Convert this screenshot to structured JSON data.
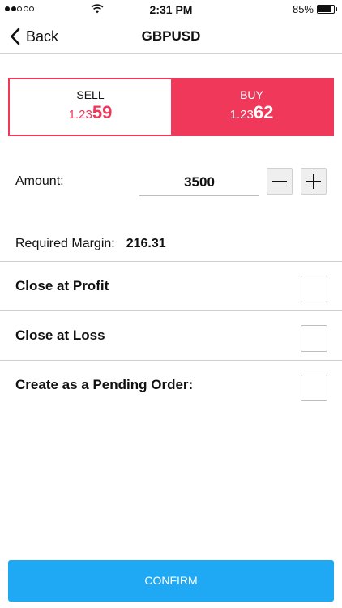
{
  "status_bar": {
    "signal_filled": 2,
    "signal_total": 5,
    "time": "2:31 PM",
    "battery_percent": "85%",
    "battery_level": 0.85
  },
  "nav": {
    "back_label": "Back",
    "title": "GBPUSD"
  },
  "trade": {
    "sell": {
      "label": "SELL",
      "price_prefix": "1.23",
      "price_suffix": "59"
    },
    "buy": {
      "label": "BUY",
      "price_prefix": "1.23",
      "price_suffix": "62"
    },
    "colors": {
      "accent": "#f0385a"
    }
  },
  "amount": {
    "label": "Amount:",
    "value": "3500"
  },
  "margin": {
    "label": "Required Margin:",
    "value": "216.31"
  },
  "options": [
    {
      "label": "Close at Profit",
      "checked": false
    },
    {
      "label": "Close at Loss",
      "checked": false
    },
    {
      "label": "Create as a Pending Order:",
      "checked": false
    }
  ],
  "confirm": {
    "label": "CONFIRM",
    "color": "#1fa9f5"
  },
  "icons": {
    "back": "chevron-left-icon",
    "minus": "minus-icon",
    "plus": "plus-icon",
    "wifi": "wifi-icon",
    "battery": "battery-icon"
  }
}
